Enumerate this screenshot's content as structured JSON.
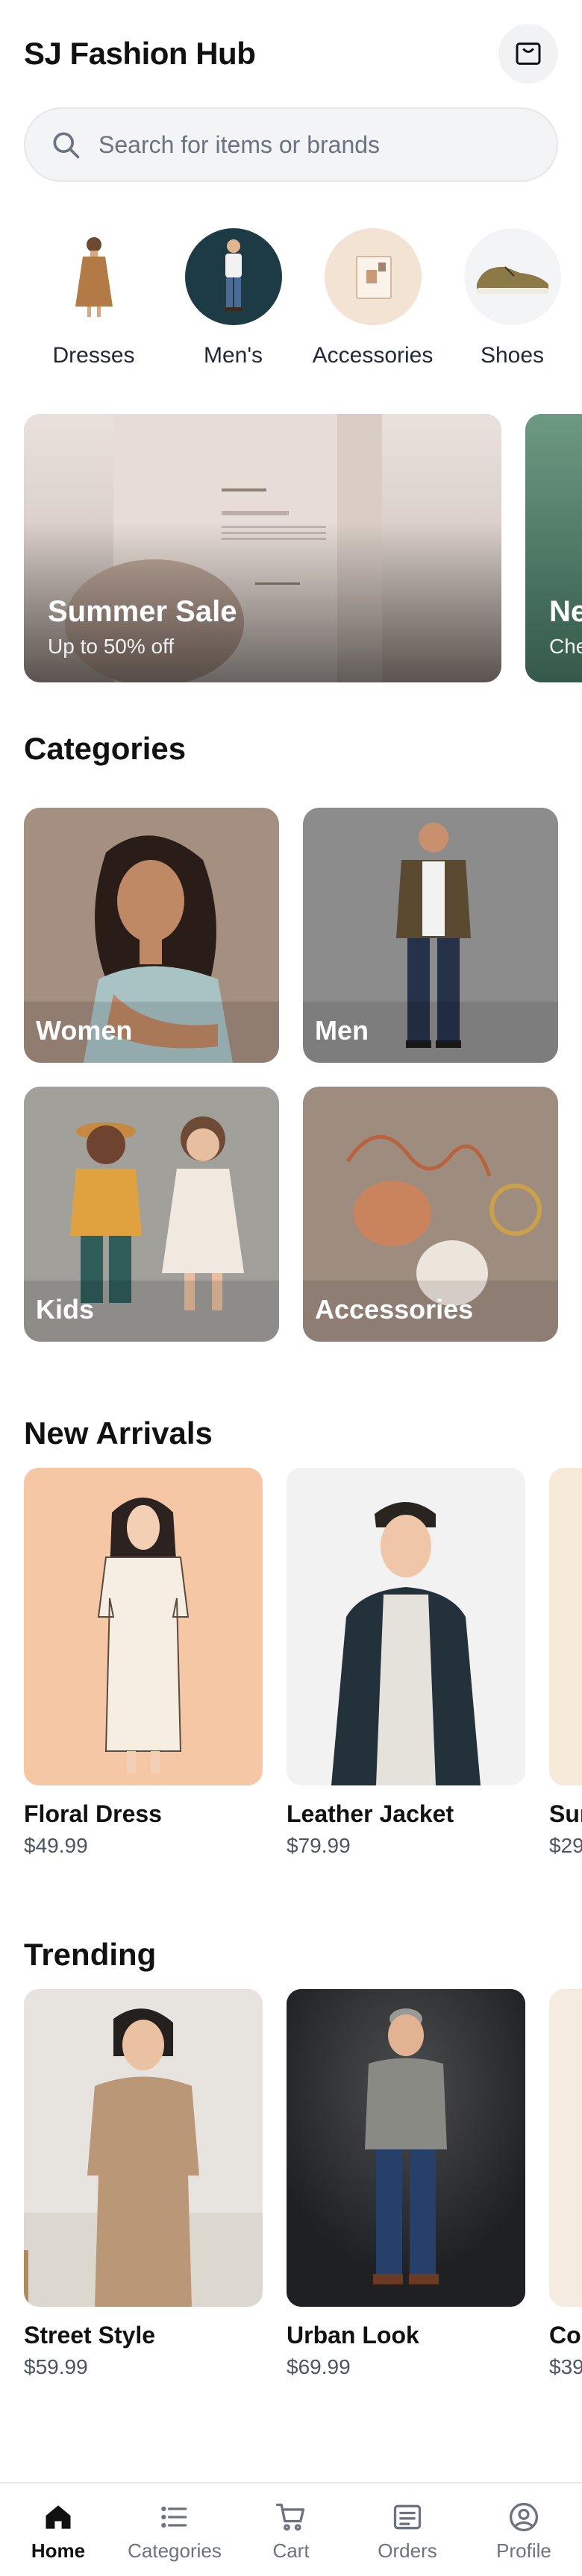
{
  "header": {
    "title": "SJ Fashion Hub",
    "bag_icon": "shopping-bag-icon"
  },
  "search": {
    "placeholder": "Search for items or brands",
    "icon": "search-icon"
  },
  "quick_categories": [
    {
      "label": "Dresses"
    },
    {
      "label": "Men's"
    },
    {
      "label": "Accessories"
    },
    {
      "label": "Shoes"
    }
  ],
  "banners": [
    {
      "title": "Summer Sale",
      "subtitle": "Up to 50% off"
    },
    {
      "title": "Ne",
      "subtitle": "Che"
    }
  ],
  "sections": {
    "categories": "Categories",
    "new_arrivals": "New Arrivals",
    "trending": "Trending"
  },
  "categories": [
    {
      "label": "Women"
    },
    {
      "label": "Men"
    },
    {
      "label": "Kids"
    },
    {
      "label": "Accessories"
    }
  ],
  "new_arrivals": [
    {
      "name": "Floral Dress",
      "price": "$49.99"
    },
    {
      "name": "Leather Jacket",
      "price": "$79.99"
    },
    {
      "name": "Sur",
      "price": "$29"
    }
  ],
  "trending": [
    {
      "name": "Street Style",
      "price": "$59.99"
    },
    {
      "name": "Urban Look",
      "price": "$69.99"
    },
    {
      "name": "Co",
      "price": "$39"
    }
  ],
  "tabbar": {
    "active": "Home",
    "items": [
      {
        "label": "Home",
        "icon": "home-icon"
      },
      {
        "label": "Categories",
        "icon": "list-icon"
      },
      {
        "label": "Cart",
        "icon": "cart-icon"
      },
      {
        "label": "Orders",
        "icon": "orders-icon"
      },
      {
        "label": "Profile",
        "icon": "profile-icon"
      }
    ]
  },
  "colors": {
    "accent": "#111111",
    "muted": "#6b7280",
    "search_bg": "#f3f4f6"
  }
}
